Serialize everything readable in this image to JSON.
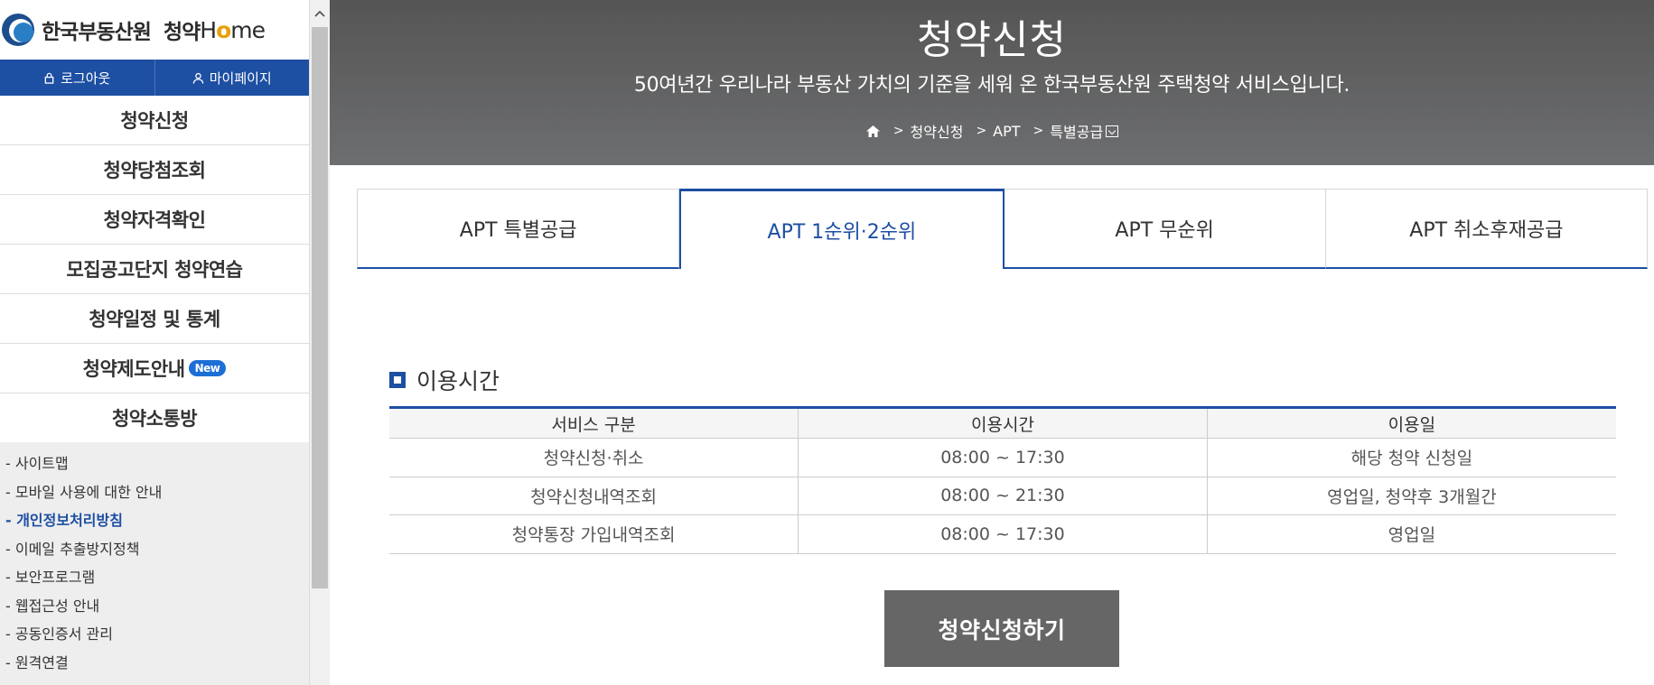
{
  "brand": {
    "org_name": "한국부동산원",
    "service_name": "청약",
    "home_word_prefix": "H",
    "home_word_accent": "o",
    "home_word_suffix": "me"
  },
  "account": {
    "logout_label": "로그아웃",
    "mypage_label": "마이페이지"
  },
  "sidebar": {
    "menu": [
      {
        "label": "청약신청"
      },
      {
        "label": "청약당첨조회"
      },
      {
        "label": "청약자격확인"
      },
      {
        "label": "모집공고단지 청약연습"
      },
      {
        "label": "청약일정 및 통계"
      },
      {
        "label": "청약제도안내",
        "badge": "New"
      },
      {
        "label": "청약소통방"
      }
    ],
    "links": [
      "- 사이트맵",
      "- 모바일 사용에 대한 안내",
      "- 개인정보처리방침",
      "- 이메일 추출방지정책",
      "- 보안프로그램",
      "- 웹접근성 안내",
      "- 공동인증서 관리",
      "- 원격연결"
    ],
    "active_link_index": 2
  },
  "header": {
    "title": "청약신청",
    "description": "50여년간 우리나라 부동산 가치의 기준을 세워 온 한국부동산원 주택청약 서비스입니다.",
    "breadcrumb": [
      "청약신청",
      "APT",
      "특별공급"
    ]
  },
  "tabs": [
    {
      "label": "APT 특별공급",
      "active": false
    },
    {
      "label": "APT 1순위·2순위",
      "active": true
    },
    {
      "label": "APT 무순위",
      "active": false
    },
    {
      "label": "APT 취소후재공급",
      "active": false
    }
  ],
  "usage": {
    "title": "이용시간",
    "columns": [
      "서비스 구분",
      "이용시간",
      "이용일"
    ],
    "rows": [
      [
        "청약신청·취소",
        "08:00 ~ 17:30",
        "해당 청약 신청일"
      ],
      [
        "청약신청내역조회",
        "08:00 ~ 21:30",
        "영업일, 청약후 3개월간"
      ],
      [
        "청약통장 가입내역조회",
        "08:00 ~ 17:30",
        "영업일"
      ]
    ]
  },
  "apply_button_label": "청약신청하기",
  "colors": {
    "primary": "#1d4fa3",
    "header_bg": "#5f6062",
    "button_bg": "#666666",
    "badge": "#1d6fd6",
    "accent": "#e8a10e"
  }
}
